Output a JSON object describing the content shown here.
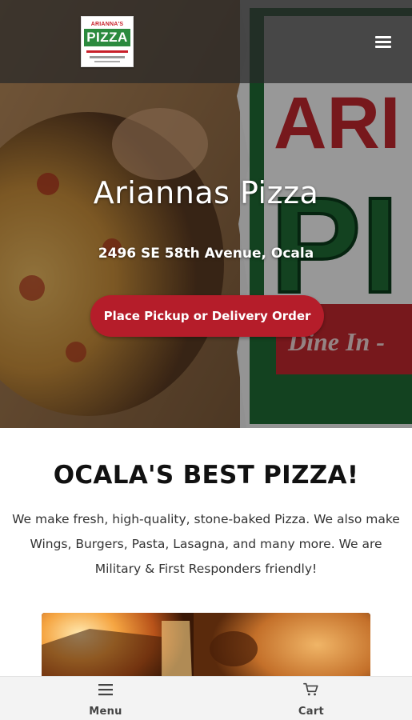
{
  "header": {
    "logo": {
      "top_text": "ARIANNA'S",
      "main_text": "PIZZA",
      "primary_color": "#c8202a",
      "secondary_color": "#2b8a3e"
    },
    "menu_icon": "hamburger-icon"
  },
  "hero": {
    "title": "Ariannas Pizza",
    "address": "2496 SE 58th Avenue, Ocala",
    "order_button_label": "Place Pickup or Delivery Order",
    "background_sign_text": {
      "word1": "ARI",
      "word2": "PI",
      "tagline": "Dine In -"
    }
  },
  "about": {
    "title": "OCALA'S BEST PIZZA!",
    "description": "We make fresh, high-quality, stone-baked Pizza. We also make Wings, Burgers, Pasta, Lasagna, and many more. We are Military & First Responders friendly!"
  },
  "bottom_nav": {
    "items": [
      {
        "label": "Menu",
        "icon": "menu-list-icon"
      },
      {
        "label": "Cart",
        "icon": "cart-icon"
      }
    ]
  },
  "colors": {
    "accent": "#b51d2a",
    "topbar": "#282828",
    "nav_background": "#f3f3f3"
  }
}
